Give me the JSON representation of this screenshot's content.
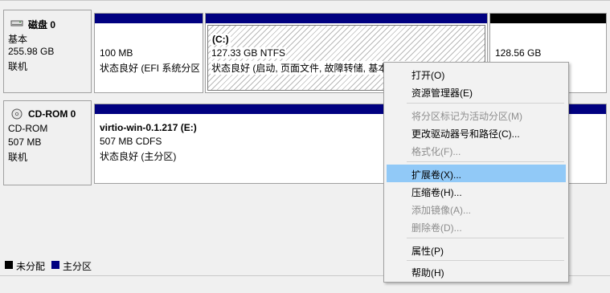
{
  "disks": [
    {
      "name": "磁盘 0",
      "type": "基本",
      "size": "255.98 GB",
      "status": "联机",
      "partitions": [
        {
          "size": "100 MB",
          "status": "状态良好 (EFI 系统分区"
        },
        {
          "letter": "(C:)",
          "size": "127.33 GB NTFS",
          "status": "状态良好 (启动, 页面文件, 故障转储, 基本数据分区"
        },
        {
          "size": "128.56 GB",
          "status": ""
        }
      ]
    },
    {
      "name": "CD-ROM 0",
      "type": "CD-ROM",
      "size": "507 MB",
      "status": "联机",
      "partitions": [
        {
          "label": "virtio-win-0.1.217  (E:)",
          "size": "507 MB CDFS",
          "status": "状态良好 (主分区)"
        }
      ]
    }
  ],
  "legend": [
    {
      "label": "未分配",
      "color": "#000000"
    },
    {
      "label": "主分区",
      "color": "#000080"
    }
  ],
  "colors": {
    "primary_bar": "#000080",
    "unallocated_bar": "#000000",
    "highlight": "#91c9f7"
  },
  "context_menu": {
    "items": [
      {
        "label": "打开(O)",
        "enabled": true
      },
      {
        "label": "资源管理器(E)",
        "enabled": true
      },
      {
        "label": "将分区标记为活动分区(M)",
        "enabled": false
      },
      {
        "label": "更改驱动器号和路径(C)...",
        "enabled": true
      },
      {
        "label": "格式化(F)...",
        "enabled": false
      },
      {
        "label": "扩展卷(X)...",
        "enabled": true,
        "highlighted": true
      },
      {
        "label": "压缩卷(H)...",
        "enabled": true
      },
      {
        "label": "添加镜像(A)...",
        "enabled": false
      },
      {
        "label": "删除卷(D)...",
        "enabled": false
      },
      {
        "label": "属性(P)",
        "enabled": true
      },
      {
        "label": "帮助(H)",
        "enabled": true
      }
    ]
  }
}
